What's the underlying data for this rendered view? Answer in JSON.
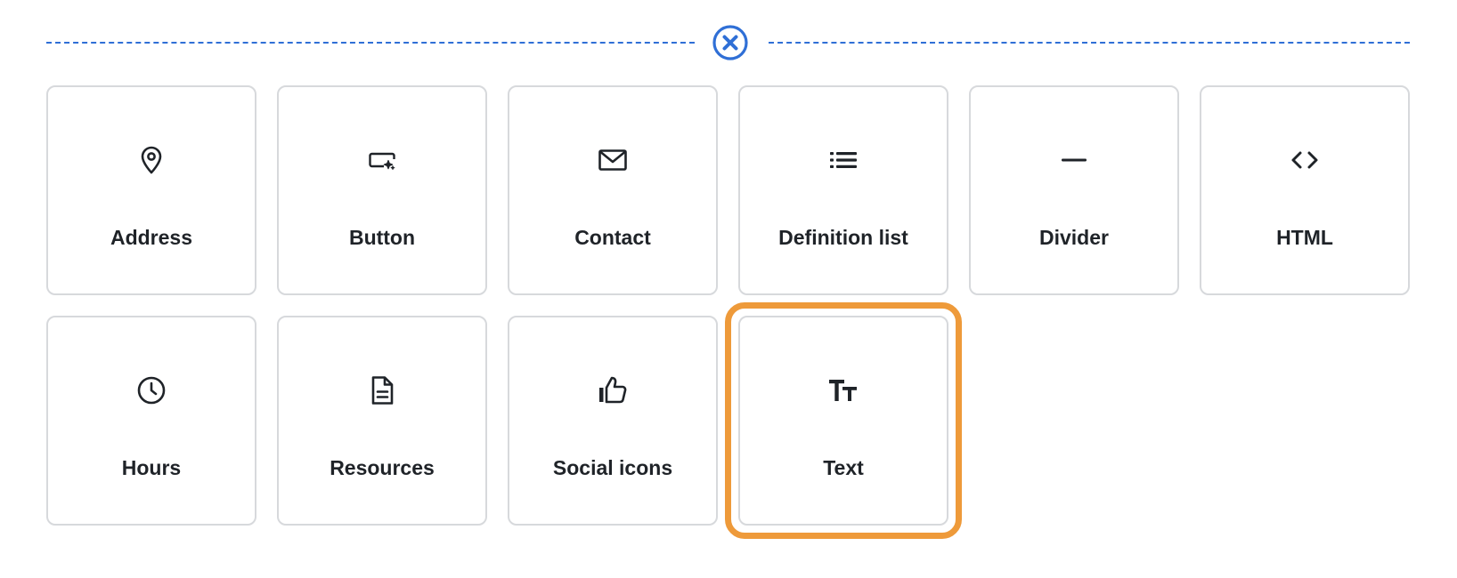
{
  "accent_color": "#2f6fd6",
  "highlight_color": "#ee9a3a",
  "insert_divider": {
    "close_icon": "close-circle-icon"
  },
  "blocks": [
    {
      "label": "Address",
      "icon": "map-pin-icon"
    },
    {
      "label": "Button",
      "icon": "button-sparkle-icon"
    },
    {
      "label": "Contact",
      "icon": "envelope-icon"
    },
    {
      "label": "Definition list",
      "icon": "list-icon"
    },
    {
      "label": "Divider",
      "icon": "horizontal-rule-icon"
    },
    {
      "label": "HTML",
      "icon": "code-brackets-icon"
    },
    {
      "label": "Hours",
      "icon": "clock-icon"
    },
    {
      "label": "Resources",
      "icon": "document-icon"
    },
    {
      "label": "Social icons",
      "icon": "thumbs-up-icon"
    },
    {
      "label": "Text",
      "icon": "text-size-icon",
      "selected": true
    }
  ]
}
